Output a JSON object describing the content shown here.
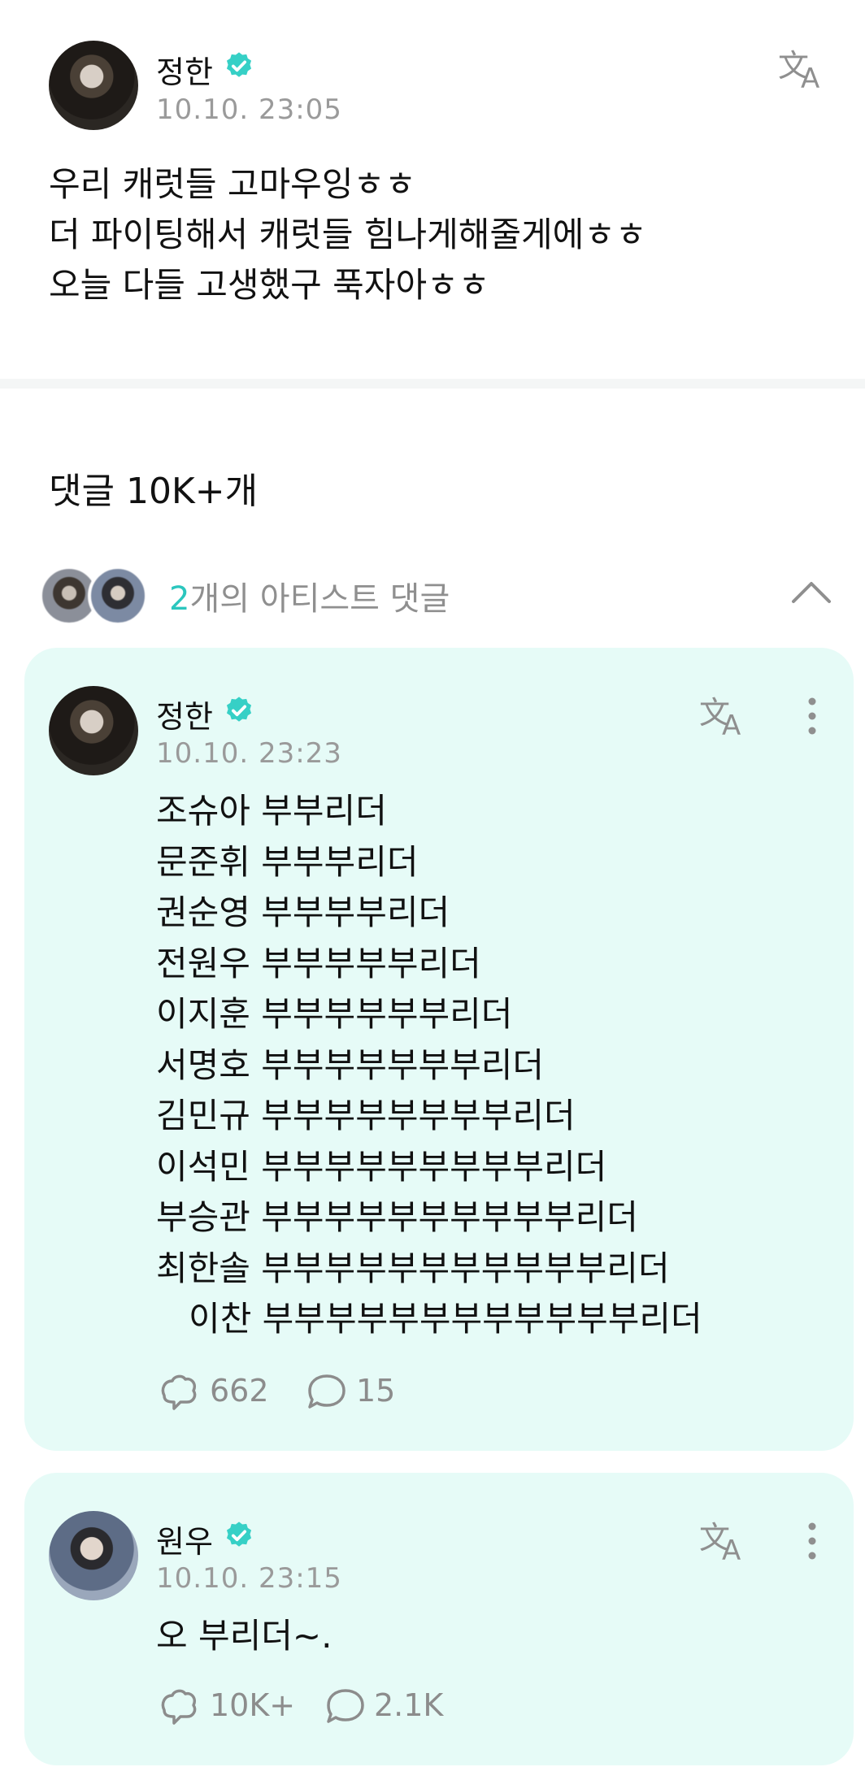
{
  "post": {
    "author": "정한",
    "time": "10.10. 23:05",
    "text": "우리 캐럿들 고마우잉ㅎㅎ\n더 파이팅해서 캐럿들 힘나게해줄게에ㅎㅎ\n오늘 다들 고생했구 푹자아ㅎㅎ",
    "icons": {
      "verified": "verified-badge-icon",
      "translate": "translate-icon"
    }
  },
  "comments_header": {
    "title": "댓글 10K+개"
  },
  "artist_comments": {
    "count": "2",
    "label": "개의 아티스트 댓글",
    "collapse_icon": "chevron-up-icon"
  },
  "comments": [
    {
      "author": "정한",
      "time": "10.10. 23:23",
      "text": "조슈아 부부리더\n문준휘 부부부리더\n권순영 부부부부리더\n전원우 부부부부부리더\n이지훈 부부부부부부리더\n서명호 부부부부부부부리더\n김민규 부부부부부부부부리더\n이석민 부부부부부부부부부리더\n부승관 부부부부부부부부부부리더\n최한솔 부부부부부부부부부부부리더\n   이찬 부부부부부부부부부부부부리더",
      "likes": "662",
      "replies": "15"
    },
    {
      "author": "원우",
      "time": "10.10. 23:15",
      "text": "오 부리더~.",
      "likes": "10K+",
      "replies": "2.1K"
    }
  ],
  "colors": {
    "accent": "#2bc6be",
    "card_bg": "#e6fbf7",
    "muted": "#9a9a9a"
  }
}
